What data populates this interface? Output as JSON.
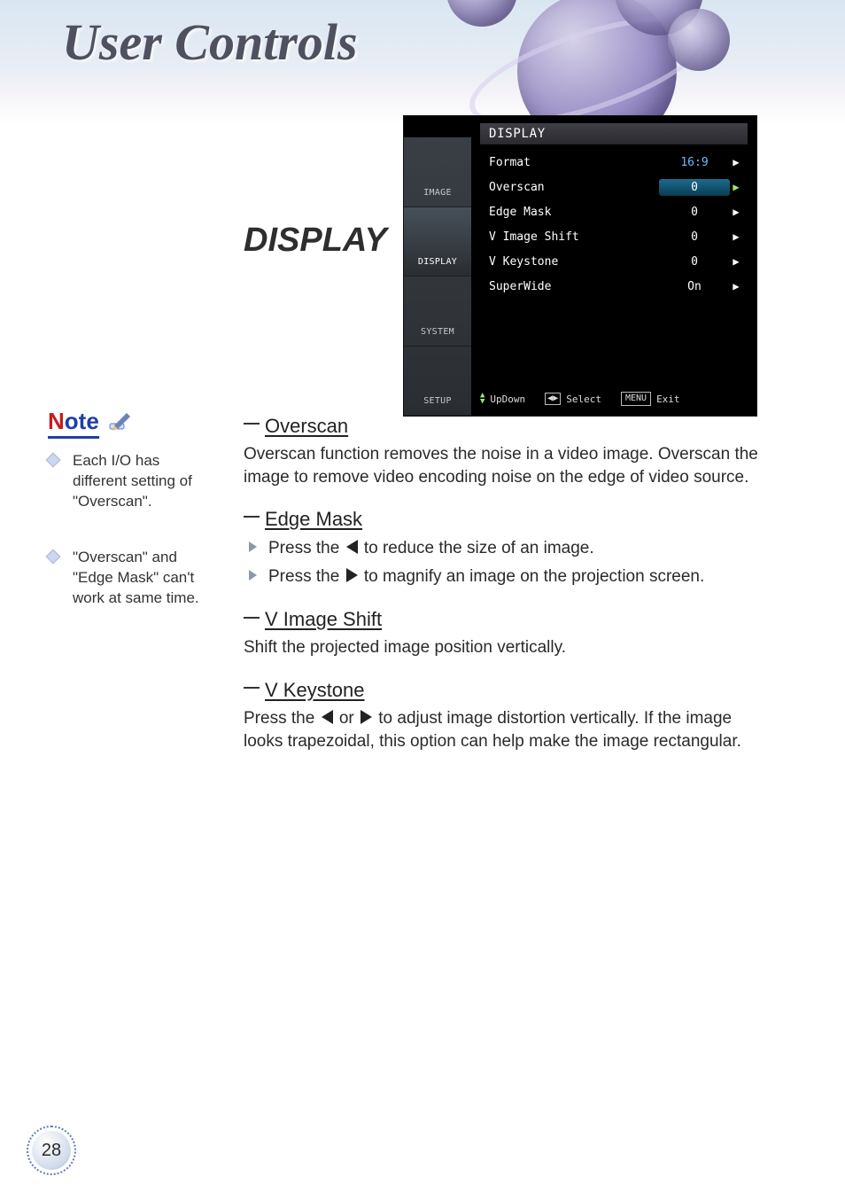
{
  "page": {
    "heading": "User Controls",
    "number": "28"
  },
  "section_title": "DISPLAY",
  "osd": {
    "header": "DISPLAY",
    "tabs": [
      "IMAGE",
      "DISPLAY",
      "SYSTEM",
      "SETUP"
    ],
    "rows": [
      {
        "label": "Format",
        "value": "16:9",
        "style": "blue"
      },
      {
        "label": "Overscan",
        "value": "0",
        "style": "boxed"
      },
      {
        "label": "Edge Mask",
        "value": "0",
        "style": ""
      },
      {
        "label": "V Image Shift",
        "value": "0",
        "style": ""
      },
      {
        "label": "V Keystone",
        "value": "0",
        "style": ""
      },
      {
        "label": "SuperWide",
        "value": "On",
        "style": ""
      }
    ],
    "footer": {
      "updown": "UpDown",
      "select": "Select",
      "menu": "MENU",
      "exit": "Exit"
    }
  },
  "note": {
    "logo": "Note",
    "items": [
      "Each I/O has different setting of \"Overscan\".",
      "\"Overscan\" and \"Edge Mask\" can't work at same time."
    ]
  },
  "sections": {
    "overscan": {
      "title": "Overscan",
      "body": "Overscan function removes the noise in a video image. Overscan the image to remove video encoding noise on the edge of video source."
    },
    "edgemask": {
      "title": "Edge Mask",
      "b1a": "Press the ",
      "b1b": " to reduce the size of an image.",
      "b2a": "Press the ",
      "b2b": " to magnify an image on the projection screen."
    },
    "vimage": {
      "title": "V Image Shift",
      "body": "Shift the projected image position vertically."
    },
    "vkeystone": {
      "title": "V Keystone",
      "b_a": "Press the ",
      "b_b": " or ",
      "b_c": " to adjust image distortion vertically. If the image looks trapezoidal, this option can help make the image rectangular."
    }
  }
}
